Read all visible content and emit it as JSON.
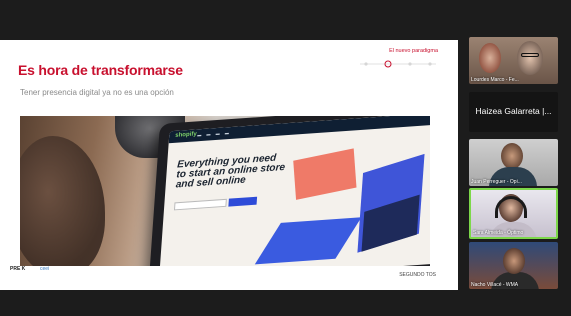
{
  "slide": {
    "title": "Es hora de transformarse",
    "subtitle": "Tener presencia digital ya no es una opción",
    "progress_label": "El nuevo paradigma",
    "progress_steps": 4,
    "progress_current": 2,
    "laptop": {
      "brand": "shopify",
      "headline": "Everything you need to start an online store and sell online"
    },
    "footer": {
      "logo_left": "PRE K",
      "logo_mid": "ceei",
      "logo_right": "SEGUNDO TOS"
    }
  },
  "participants": [
    {
      "name": "Lourdes Marco - Fe..."
    },
    {
      "name": "Haizea Galarreta |..."
    },
    {
      "name": "Juan Perreguer - Opi..."
    },
    {
      "name": "Sara Almeida - Óptimo"
    },
    {
      "name": "Nacho Villacé - WMA"
    }
  ],
  "colors": {
    "accent": "#c8102e",
    "active_speaker": "#7dd84a"
  }
}
